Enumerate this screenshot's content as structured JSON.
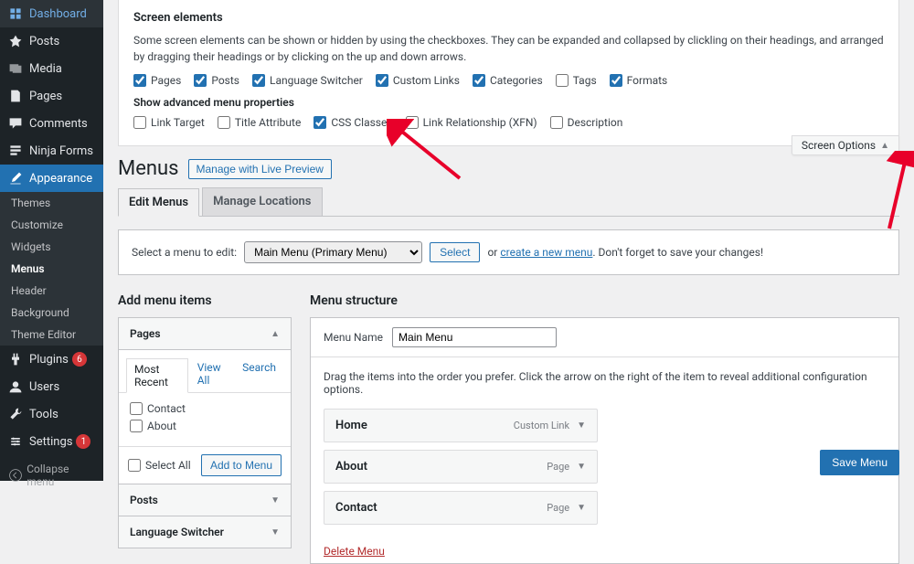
{
  "sidebar": {
    "items": [
      {
        "label": "Dashboard",
        "icon": "dashboard"
      },
      {
        "label": "Posts",
        "icon": "pin"
      },
      {
        "label": "Media",
        "icon": "media"
      },
      {
        "label": "Pages",
        "icon": "page"
      },
      {
        "label": "Comments",
        "icon": "comment"
      },
      {
        "label": "Ninja Forms",
        "icon": "form"
      },
      {
        "label": "Appearance",
        "icon": "brush",
        "active": true
      },
      {
        "label": "Plugins",
        "icon": "plugin",
        "badge": "6"
      },
      {
        "label": "Users",
        "icon": "user"
      },
      {
        "label": "Tools",
        "icon": "wrench"
      },
      {
        "label": "Settings",
        "icon": "settings",
        "badge": "1"
      }
    ],
    "appearance_sub": [
      "Themes",
      "Customize",
      "Widgets",
      "Menus",
      "Header",
      "Background",
      "Theme Editor"
    ],
    "appearance_sub_active": "Menus",
    "collapse": "Collapse menu"
  },
  "screen_options": {
    "toggle_label": "Screen Options",
    "heading": "Screen elements",
    "description": "Some screen elements can be shown or hidden by using the checkboxes. They can be expanded and collapsed by clickling on their headings, and arranged by dragging their headings or by clicking on the up and down arrows.",
    "boxes": [
      {
        "label": "Pages",
        "checked": true
      },
      {
        "label": "Posts",
        "checked": true
      },
      {
        "label": "Language Switcher",
        "checked": true
      },
      {
        "label": "Custom Links",
        "checked": true
      },
      {
        "label": "Categories",
        "checked": true
      },
      {
        "label": "Tags",
        "checked": false
      },
      {
        "label": "Formats",
        "checked": true
      }
    ],
    "adv_heading": "Show advanced menu properties",
    "adv_boxes": [
      {
        "label": "Link Target",
        "checked": false
      },
      {
        "label": "Title Attribute",
        "checked": false
      },
      {
        "label": "CSS Classes",
        "checked": true
      },
      {
        "label": "Link Relationship (XFN)",
        "checked": false
      },
      {
        "label": "Description",
        "checked": false
      }
    ]
  },
  "page_title": "Menus",
  "live_preview_btn": "Manage with Live Preview",
  "tabs": {
    "edit": "Edit Menus",
    "locations": "Manage Locations"
  },
  "select_menu": {
    "prefix": "Select a menu to edit:",
    "selected": "Main Menu (Primary Menu)",
    "button": "Select",
    "or": "or",
    "create_link": "create a new menu",
    "suffix": ". Don't forget to save your changes!"
  },
  "add_items": {
    "heading": "Add menu items",
    "panels": [
      "Pages",
      "Posts",
      "Language Switcher"
    ],
    "pages_inner_tabs": [
      "Most Recent",
      "View All",
      "Search"
    ],
    "pages_items": [
      "Contact",
      "About"
    ],
    "select_all": "Select All",
    "add_btn": "Add to Menu"
  },
  "structure": {
    "heading": "Menu structure",
    "name_label": "Menu Name",
    "name_value": "Main Menu",
    "drag_hint": "Drag the items into the order you prefer. Click the arrow on the right of the item to reveal additional configuration options.",
    "items": [
      {
        "label": "Home",
        "type": "Custom Link"
      },
      {
        "label": "About",
        "type": "Page"
      },
      {
        "label": "Contact",
        "type": "Page"
      }
    ],
    "delete_link": "Delete Menu",
    "save_btn": "Save Menu"
  }
}
